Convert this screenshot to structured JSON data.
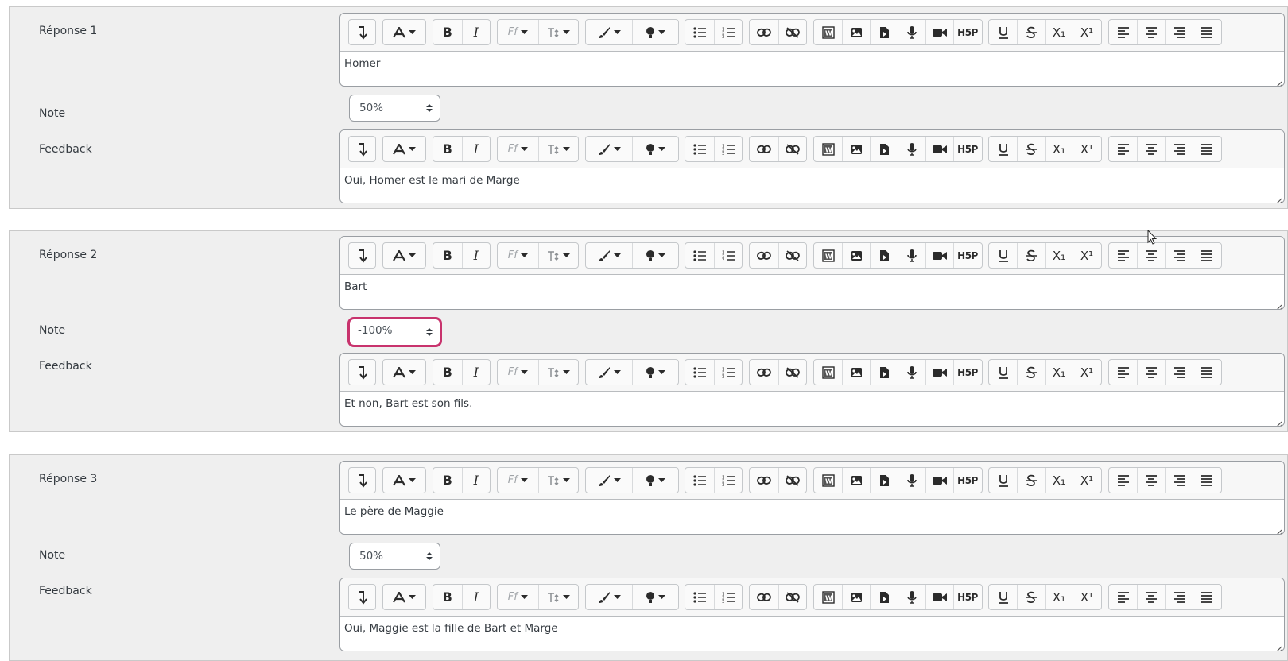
{
  "answers": [
    {
      "label": "Réponse 1",
      "text": "Homer",
      "grade_label": "Note",
      "grade_value": "50%",
      "feedback_label": "Feedback",
      "feedback_text": "Oui, Homer est le mari de Marge"
    },
    {
      "label": "Réponse 2",
      "text": "Bart",
      "grade_label": "Note",
      "grade_value": "-100%",
      "feedback_label": "Feedback",
      "feedback_text": "Et non, Bart est son fils."
    },
    {
      "label": "Réponse 3",
      "text": "Le père de Maggie",
      "grade_label": "Note",
      "grade_value": "50%",
      "feedback_label": "Feedback",
      "feedback_text": "Oui, Maggie est la fille de Bart et Marge"
    }
  ],
  "toolbar": {
    "font_family_glyph": "Ff",
    "superscript_glyph": "X¹",
    "subscript_glyph": "X₁",
    "h5p_glyph": "H5P"
  },
  "colors": {
    "focus_ring": "#c8336d",
    "panel_background": "#efefef"
  },
  "icons": [
    "collapse-toolbar-icon",
    "font-color-icon",
    "bold-icon",
    "italic-icon",
    "font-family-icon",
    "font-size-icon",
    "background-color-icon",
    "highlight-icon",
    "bullet-list-icon",
    "numbered-list-icon",
    "link-icon",
    "unlink-icon",
    "word-import-icon",
    "image-icon",
    "media-file-icon",
    "microphone-icon",
    "video-icon",
    "h5p-icon",
    "underline-icon",
    "strikethrough-icon",
    "subscript-icon",
    "superscript-icon",
    "align-left-icon",
    "align-center-icon",
    "align-right-icon",
    "justify-icon"
  ]
}
